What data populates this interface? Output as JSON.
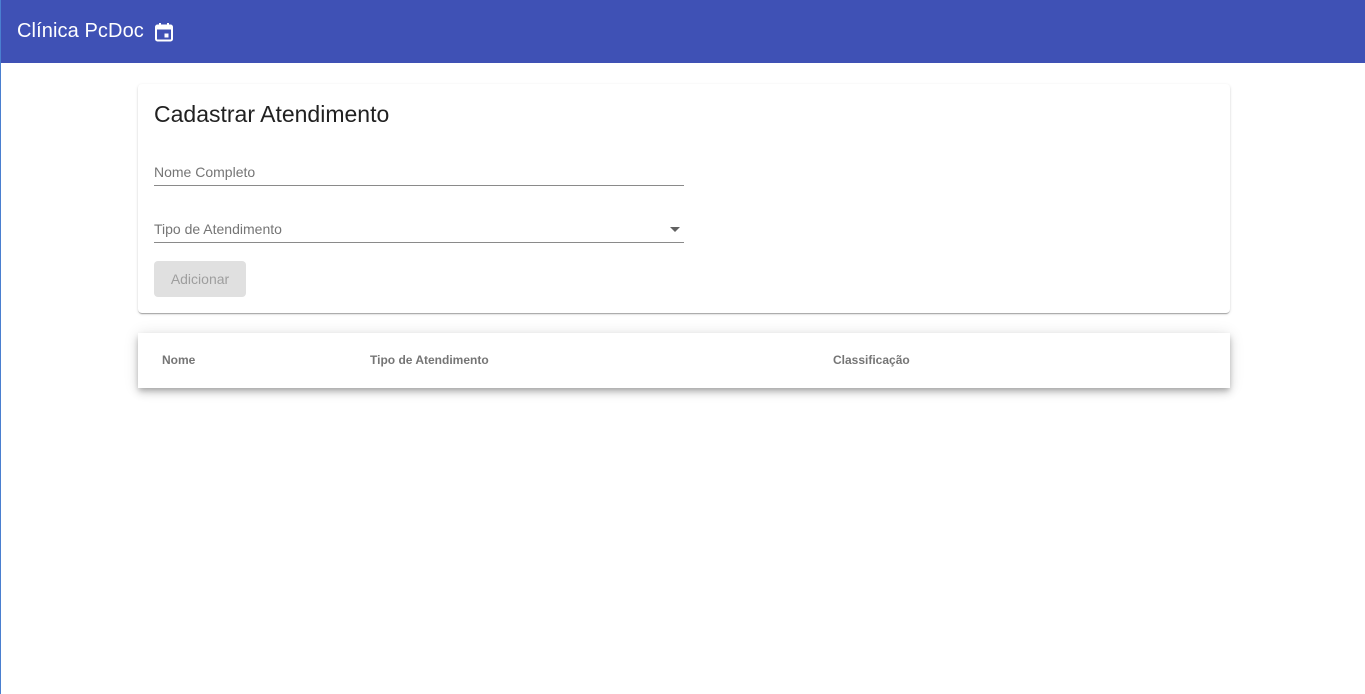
{
  "header": {
    "title": "Clínica PcDoc",
    "icon": "calendar-icon",
    "background": "#3f51b5"
  },
  "form": {
    "title": "Cadastrar Atendimento",
    "name_placeholder": "Nome Completo",
    "type_placeholder": "Tipo de Atendimento",
    "add_label": "Adicionar"
  },
  "table": {
    "columns": [
      "Nome",
      "Tipo de Atendimento",
      "Classificação"
    ],
    "rows": []
  }
}
